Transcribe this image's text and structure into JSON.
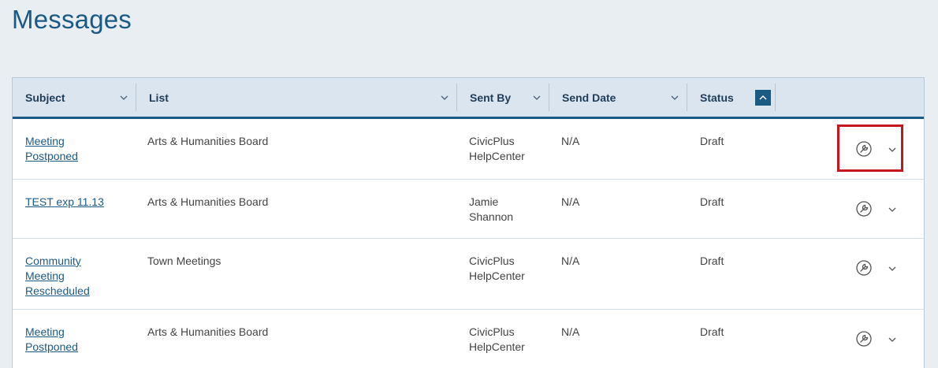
{
  "page": {
    "title": "Messages"
  },
  "colors": {
    "accent": "#1c5a86",
    "header_bg": "#dbe5f0",
    "highlight": "#c4161c"
  },
  "table": {
    "columns": [
      {
        "key": "subject",
        "label": "Subject",
        "control": "chevron-down-icon"
      },
      {
        "key": "list",
        "label": "List",
        "control": "chevron-down-icon"
      },
      {
        "key": "sent_by",
        "label": "Sent By",
        "control": "chevron-down-icon"
      },
      {
        "key": "send_date",
        "label": "Send Date",
        "control": "chevron-down-icon"
      },
      {
        "key": "status",
        "label": "Status",
        "control": "sort-ascending-icon"
      }
    ],
    "rows": [
      {
        "subject": "Meeting Postponed",
        "list": "Arts & Humanities Board",
        "sent_by": "CivicPlus HelpCenter",
        "send_date": "N/A",
        "status": "Draft"
      },
      {
        "subject": "TEST exp 11.13",
        "list": "Arts & Humanities Board",
        "sent_by": "Jamie Shannon",
        "send_date": "N/A",
        "status": "Draft"
      },
      {
        "subject": "Community Meeting Rescheduled",
        "list": "Town Meetings",
        "sent_by": "CivicPlus HelpCenter",
        "send_date": "N/A",
        "status": "Draft"
      },
      {
        "subject": "Meeting Postponed",
        "list": "Arts & Humanities Board",
        "sent_by": "CivicPlus HelpCenter",
        "send_date": "N/A",
        "status": "Draft"
      }
    ],
    "row_actions": {
      "tools_icon": "wrench-icon",
      "more_icon": "chevron-down-icon"
    }
  }
}
